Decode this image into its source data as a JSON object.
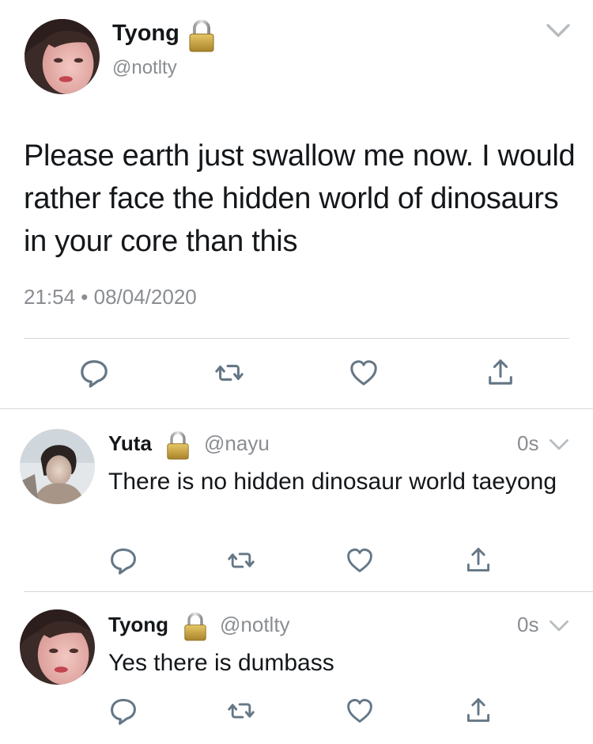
{
  "tweet": {
    "display_name": "Tyong",
    "handle": "@notlty",
    "text": "Please earth just swallow me now. I would rather face the hidden world of dinosaurs in your core than this",
    "timestamp": "21:54 • 08/04/2020",
    "protected_icon": "lock-icon",
    "menu_icon": "chevron-down-icon",
    "actions": [
      "reply-icon",
      "retweet-icon",
      "like-icon",
      "share-icon"
    ]
  },
  "replies": [
    {
      "display_name": "Yuta",
      "handle": "@nayu",
      "time": "0s",
      "text": "There is no hidden dinosaur world taeyong",
      "protected_icon": "lock-icon"
    },
    {
      "display_name": "Tyong",
      "handle": "@notlty",
      "time": "0s",
      "text": "Yes there is dumbass",
      "protected_icon": "lock-icon"
    }
  ],
  "colors": {
    "text_primary": "#14171a",
    "text_secondary": "#8a8d91",
    "icon": "#657786",
    "divider": "#d4d7da",
    "lock_gold": "#c8a23c"
  }
}
